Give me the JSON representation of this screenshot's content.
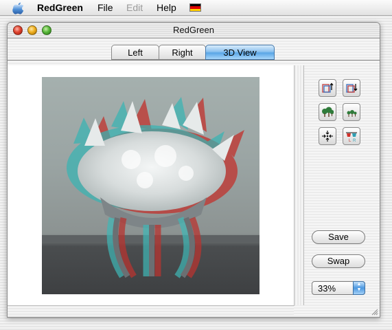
{
  "menubar": {
    "app_name": "RedGreen",
    "items": [
      "File",
      "Edit",
      "Help"
    ],
    "flag_colors": [
      "#000000",
      "#dd0000",
      "#ffce00"
    ]
  },
  "window": {
    "title": "RedGreen"
  },
  "tabs": [
    {
      "label": "Left",
      "selected": false
    },
    {
      "label": "Right",
      "selected": false
    },
    {
      "label": "3D View",
      "selected": true
    }
  ],
  "toolbar": {
    "tools": [
      {
        "icon": "move-up-icon"
      },
      {
        "icon": "move-down-icon"
      },
      {
        "icon": "trees-large-icon"
      },
      {
        "icon": "trees-small-icon"
      },
      {
        "icon": "center-arrows-icon"
      },
      {
        "icon": "3d-glasses-icon"
      }
    ],
    "save_label": "Save",
    "swap_label": "Swap",
    "zoom_value": "33%"
  },
  "image": {
    "description_icon": "anaglyph-coral-photo"
  },
  "colors": {
    "accent": "#5aa6e6",
    "anaglyph_red": "#d2302a",
    "anaglyph_cyan": "#2fb3b3"
  }
}
